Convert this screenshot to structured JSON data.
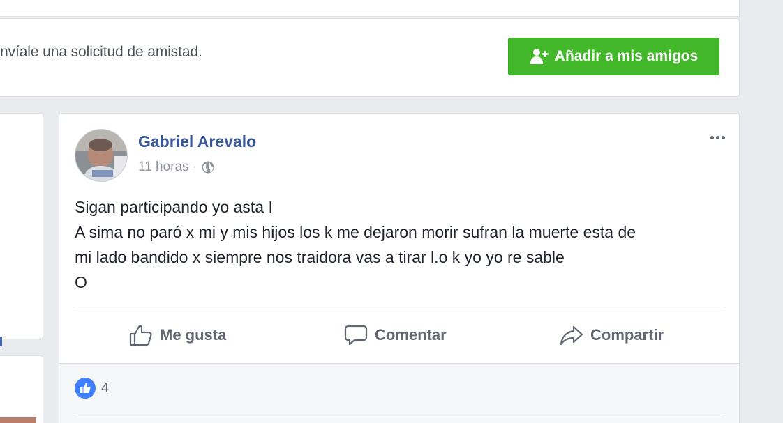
{
  "friend_request": {
    "text": "nvíale una solicitud de amistad.",
    "button_label": "Añadir a mis amigos"
  },
  "post": {
    "author": "Gabriel Arevalo",
    "time": "11 horas",
    "separator": "·",
    "privacy_icon": "globe-icon",
    "lines": [
      "Sigan participando yo asta I",
      "A sima no paró x mi y mis hijos los k me dejaron morir sufran la muerte esta de",
      "mi lado bandido x siempre nos traidora vas a tirar l.o k yo yo re sable",
      "O"
    ],
    "actions": {
      "like": "Me gusta",
      "comment": "Comentar",
      "share": "Compartir"
    },
    "reaction_count": "4"
  },
  "colors": {
    "accent_green": "#42b72a",
    "link_blue": "#385898",
    "like_blue": "#4080ff",
    "background": "#e9ebee"
  }
}
